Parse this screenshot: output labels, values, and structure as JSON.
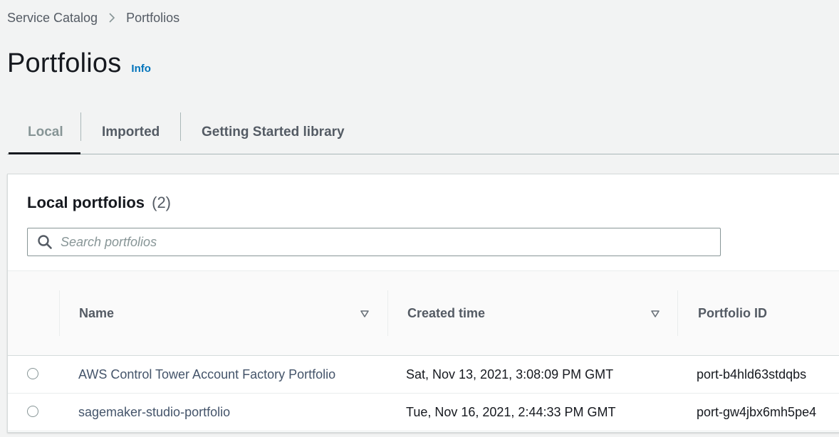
{
  "breadcrumb": {
    "root": "Service Catalog",
    "current": "Portfolios"
  },
  "page": {
    "title": "Portfolios",
    "info_label": "Info"
  },
  "tabs": [
    {
      "label": "Local",
      "selected": true
    },
    {
      "label": "Imported",
      "selected": false
    },
    {
      "label": "Getting Started library",
      "selected": false
    }
  ],
  "panel": {
    "title": "Local portfolios",
    "count": "(2)",
    "search_placeholder": "Search portfolios"
  },
  "table": {
    "columns": [
      "Name",
      "Created time",
      "Portfolio ID"
    ],
    "rows": [
      {
        "name": "AWS Control Tower Account Factory Portfolio",
        "created": "Sat, Nov 13, 2021, 3:08:09 PM GMT",
        "id": "port-b4hld63stdqbs"
      },
      {
        "name": "sagemaker-studio-portfolio",
        "created": "Tue, Nov 16, 2021, 2:44:33 PM GMT",
        "id": "port-gw4jbx6mh5pe4"
      }
    ]
  },
  "colors": {
    "accent_link": "#0073bb",
    "background": "#f2f3f3",
    "text_primary": "#16191f",
    "text_secondary": "#545b64"
  }
}
